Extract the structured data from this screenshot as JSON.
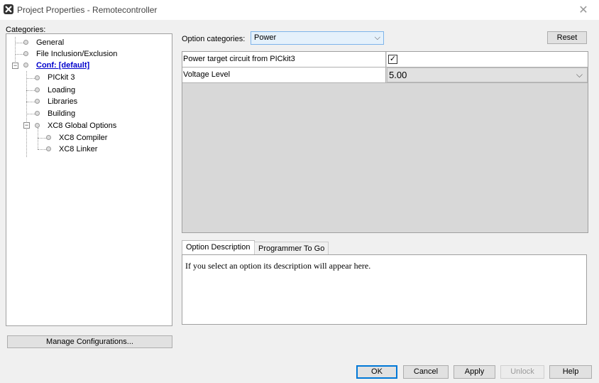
{
  "window": {
    "title": "Project Properties - Remotecontroller",
    "close_glyph": "✕",
    "app_icon": "mplab-x-icon"
  },
  "categories": {
    "label": "Categories:",
    "items": [
      {
        "label": "General"
      },
      {
        "label": "File Inclusion/Exclusion"
      },
      {
        "label": "Conf: [default]"
      },
      {
        "label": "PICkit 3"
      },
      {
        "label": "Loading"
      },
      {
        "label": "Libraries"
      },
      {
        "label": "Building"
      },
      {
        "label": "XC8 Global Options"
      },
      {
        "label": "XC8 Compiler"
      },
      {
        "label": "XC8 Linker"
      }
    ],
    "selected": "PICkit 3"
  },
  "manage_button": "Manage Configurations...",
  "option_categories": {
    "label": "Option categories:",
    "value": "Power",
    "chevron": "⌵"
  },
  "reset_button": "Reset",
  "grid": {
    "rows": [
      {
        "name": "Power target circuit from PICkit3",
        "checked": true,
        "check_glyph": "✓"
      },
      {
        "name": "Voltage Level",
        "value": "5.00",
        "chevron": "⌵"
      }
    ]
  },
  "tabs": [
    {
      "label": "Option Description",
      "active": true
    },
    {
      "label": "Programmer To Go",
      "active": false
    }
  ],
  "description": "If you select an option its description will appear here.",
  "buttons": {
    "ok": "OK",
    "cancel": "Cancel",
    "apply": "Apply",
    "unlock": "Unlock",
    "help": "Help"
  }
}
